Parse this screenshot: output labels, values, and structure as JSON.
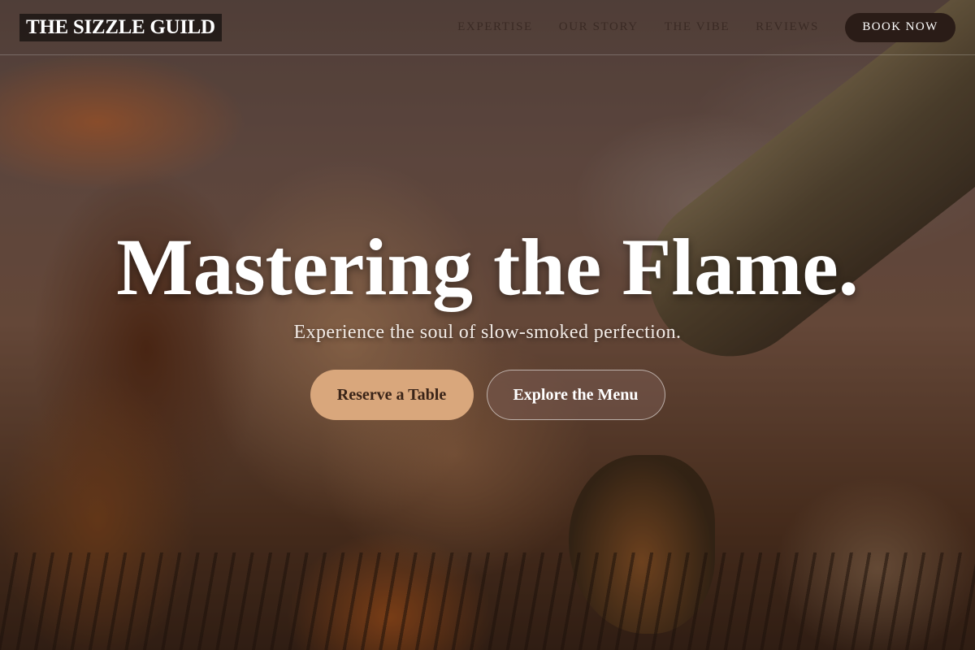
{
  "header": {
    "logo": "THE SIZZLE GUILD",
    "nav": [
      {
        "label": "EXPERTISE"
      },
      {
        "label": "OUR STORY"
      },
      {
        "label": "THE VIBE"
      },
      {
        "label": "REVIEWS"
      }
    ],
    "cta_label": "BOOK NOW"
  },
  "hero": {
    "title": "Mastering the Flame.",
    "subtitle": "Experience the soul of slow-smoked perfection.",
    "primary_button": "Reserve a Table",
    "secondary_button": "Explore the Menu",
    "background_image": "grilled-meat-with-tongs-photo"
  },
  "colors": {
    "accent": "#d9a77c",
    "cta_dark": "#2a1c17",
    "nav_text": "#3a2a24",
    "title_text": "#ffffff"
  }
}
